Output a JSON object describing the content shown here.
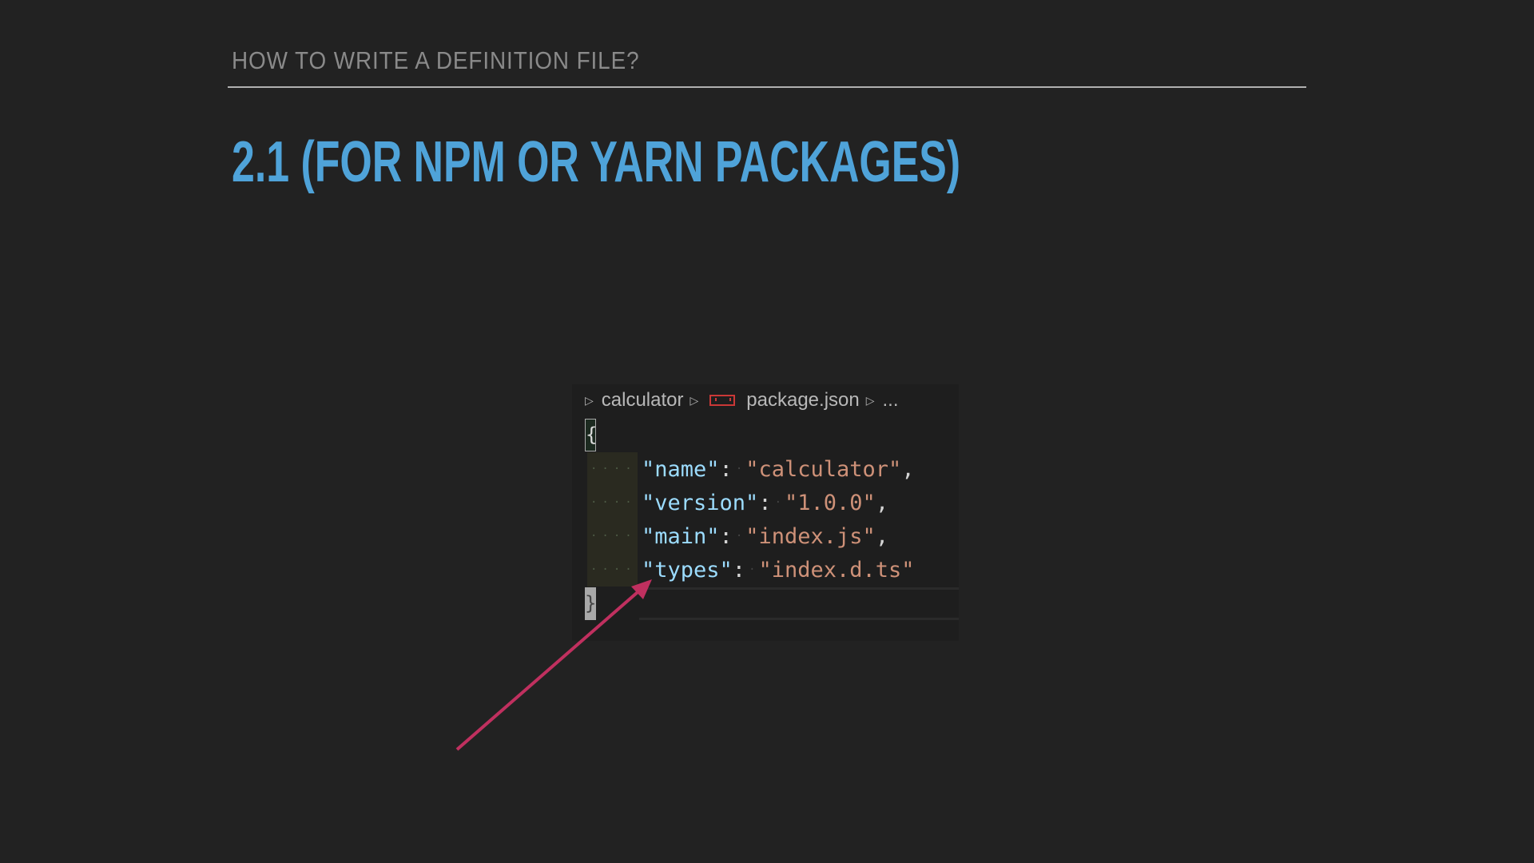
{
  "slide": {
    "subtitle": "HOW TO WRITE A DEFINITION FILE?",
    "title": "2.1 (FOR NPM OR YARN PACKAGES)"
  },
  "editor": {
    "breadcrumb": [
      "calculator",
      "package.json",
      "..."
    ],
    "open_brace": "{",
    "close_brace": "}",
    "lines": [
      {
        "key": "\"name\"",
        "value": "\"calculator\"",
        "trail": ","
      },
      {
        "key": "\"version\"",
        "value": "\"1.0.0\"",
        "trail": ","
      },
      {
        "key": "\"main\"",
        "value": "\"index.js\"",
        "trail": ","
      },
      {
        "key": "\"types\"",
        "value": "\"index.d.ts\"",
        "trail": ""
      }
    ]
  },
  "colors": {
    "accent": "#4fa3d9",
    "arrow": "#c0305f",
    "npm": "#cb3837"
  }
}
